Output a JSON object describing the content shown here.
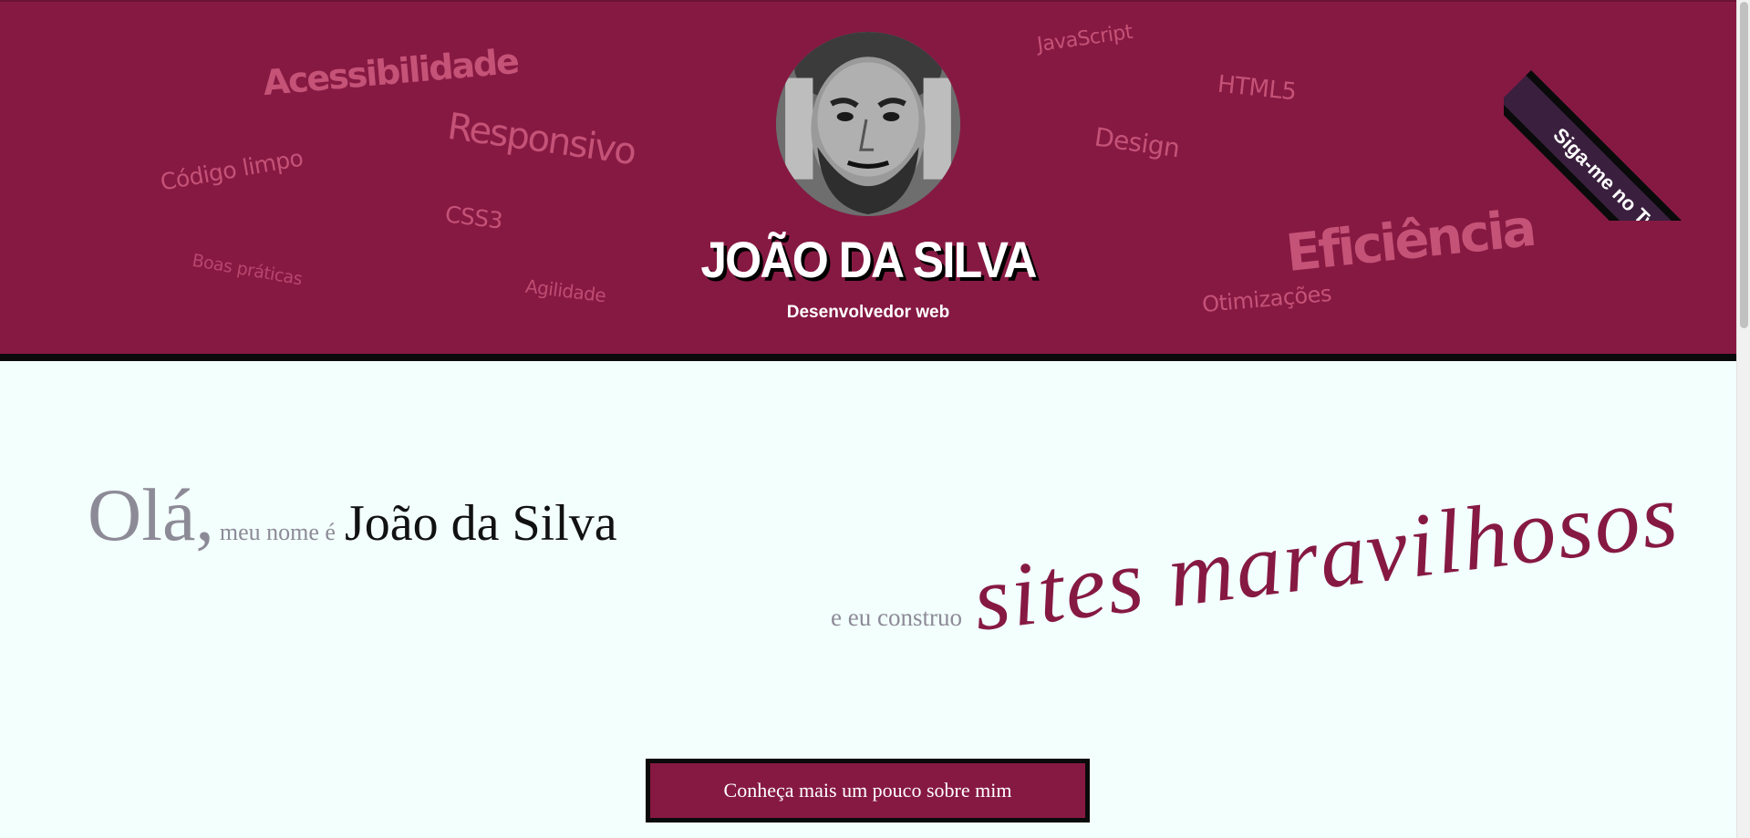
{
  "header": {
    "name": "JOÃO DA SILVA",
    "role": "Desenvolvedor web",
    "twitter_ribbon": "Siga-me no Twitter",
    "tags": {
      "acessibilidade": "Acessibilidade",
      "responsivo": "Responsivo",
      "codigo_limpo": "Código limpo",
      "css3": "CSS3",
      "boas_praticas": "Boas práticas",
      "agilidade": "Agilidade",
      "javascript": "JavaScript",
      "html5": "HTML5",
      "design": "Design",
      "eficiencia": "Eficiência",
      "otimizacoes": "Otimizações"
    }
  },
  "intro": {
    "greeting": "Olá,",
    "name_prefix": "meu nome é",
    "name": "João da Silva",
    "build_prefix": "e eu construo",
    "highlight": "sites maravilhosos"
  },
  "cta": {
    "label": "Conheça mais um pouco sobre mim"
  },
  "colors": {
    "brand": "#861942",
    "tag": "#c9567a",
    "background": "#f2fffc",
    "muted_text": "#8d8a97",
    "ribbon": "#3a1f3e"
  }
}
